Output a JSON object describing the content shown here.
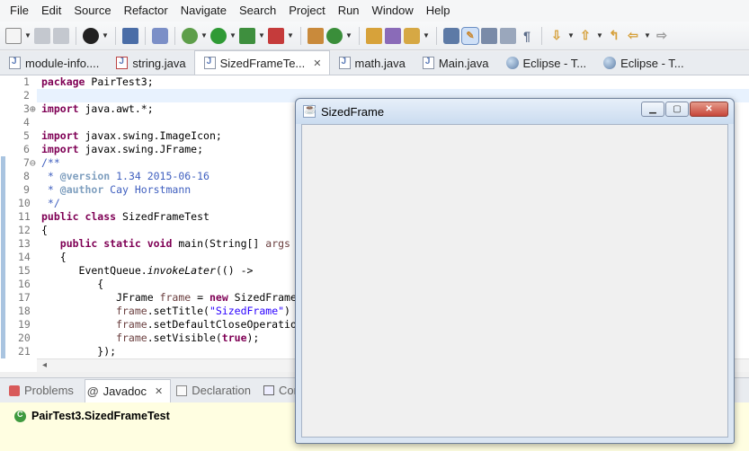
{
  "menu": [
    "File",
    "Edit",
    "Source",
    "Refactor",
    "Navigate",
    "Search",
    "Project",
    "Run",
    "Window",
    "Help"
  ],
  "editor_tabs": [
    {
      "label": "module-info....",
      "icon": "java-file-icon",
      "active": false
    },
    {
      "label": "string.java",
      "icon": "java-file-error-icon",
      "active": false
    },
    {
      "label": "SizedFrameTe...",
      "icon": "java-file-icon",
      "active": true,
      "close": "✕"
    },
    {
      "label": "math.java",
      "icon": "java-file-icon",
      "active": false
    },
    {
      "label": "Main.java",
      "icon": "java-file-icon",
      "active": false
    },
    {
      "label": "Eclipse - T...",
      "icon": "globe-icon",
      "active": false
    },
    {
      "label": "Eclipse - T...",
      "icon": "globe-icon",
      "active": false
    }
  ],
  "line_numbers": [
    "1",
    "2",
    "3⊕",
    "4",
    "5",
    "6",
    "7⊖",
    "8",
    "9",
    "10",
    "11",
    "12",
    "13",
    "14",
    "15",
    "16",
    "17",
    "18",
    "19",
    "20",
    "21"
  ],
  "code_lines": {
    "l1_kw": "package",
    "l1_rest": " PairTest3;",
    "l3_kw": "import",
    "l3_rest": " java.awt.*;",
    "l5_kw": "import",
    "l5_rest": " javax.swing.ImageIcon;",
    "l6_kw": "import",
    "l6_rest": " javax.swing.JFrame;",
    "l7": "/**",
    "l8_a": " * ",
    "l8_tag": "@version",
    "l8_b": " 1.34 2015-06-16",
    "l9_a": " * ",
    "l9_tag": "@author",
    "l9_b": " Cay Horstmann",
    "l10": " */",
    "l11_kw": "public class",
    "l11_rest": " SizedFrameTest",
    "l12": "{",
    "l13_pad": "   ",
    "l13_kw": "public static void",
    "l13_rest": " main(String[] ",
    "l13_arg": "args",
    "l14": "   {",
    "l15_a": "      EventQueue.",
    "l15_it": "invokeLater",
    "l15_b": "(() ->",
    "l16": "         {",
    "l17_a": "            JFrame ",
    "l17_fld": "frame",
    "l17_b": " = ",
    "l17_kw": "new",
    "l17_c": " SizedFrame",
    "l18_fld": "            frame",
    "l18_b": ".setTitle(",
    "l18_st": "\"SizedFrame\"",
    "l18_c": ")",
    "l19_fld": "            frame",
    "l19_b": ".setDefaultCloseOperatio",
    "l20_fld": "            frame",
    "l20_b": ".setVisible(",
    "l20_kw": "true",
    "l20_c": ");",
    "l21": "         });"
  },
  "bottom_tabs": [
    {
      "label": "Problems",
      "icon": "problems-icon",
      "active": false
    },
    {
      "label": "Javadoc",
      "icon": "at-icon",
      "active": true,
      "close": "✕"
    },
    {
      "label": "Declaration",
      "icon": "declaration-icon",
      "active": false
    },
    {
      "label": "Con",
      "icon": "console-icon",
      "active": false
    }
  ],
  "javadoc_title": "PairTest3.SizedFrameTest",
  "frame": {
    "title": "SizedFrame",
    "close_glyph": "✕",
    "min_glyph": "▁",
    "max_glyph": "▢"
  },
  "scroll_glyph": "◂"
}
